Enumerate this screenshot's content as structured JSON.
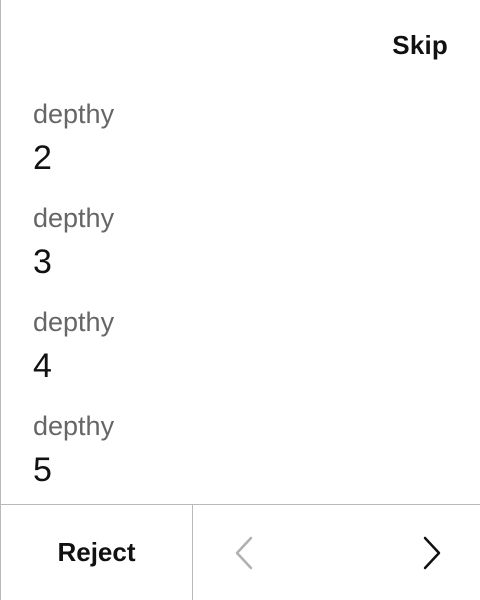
{
  "header": {
    "skip_label": "Skip"
  },
  "items": [
    {
      "label": "depthy",
      "value": "2"
    },
    {
      "label": "depthy",
      "value": "3"
    },
    {
      "label": "depthy",
      "value": "4"
    },
    {
      "label": "depthy",
      "value": "5"
    }
  ],
  "footer": {
    "reject_label": "Reject",
    "prev_icon": "chevron-left-icon",
    "next_icon": "chevron-right-icon",
    "prev_enabled": false,
    "next_enabled": true
  },
  "colors": {
    "text_primary": "#111111",
    "text_secondary": "#666666",
    "divider": "#b9b9b9",
    "disabled": "#b0b0b0",
    "background": "#ffffff"
  }
}
